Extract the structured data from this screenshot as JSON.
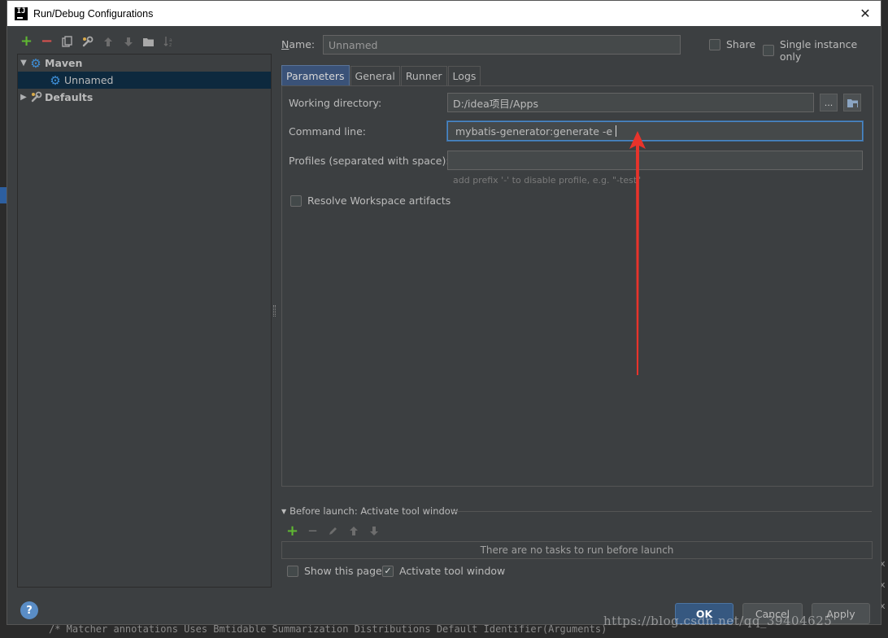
{
  "window": {
    "title": "Run/Debug Configurations",
    "app_icon_text": "IJ"
  },
  "tree": {
    "items": [
      {
        "label": "Maven",
        "expanded": true,
        "bold": true
      },
      {
        "label": "Unnamed",
        "selected": true
      },
      {
        "label": "Defaults",
        "expanded": false,
        "bold": true
      }
    ]
  },
  "form": {
    "name_label": "Name:",
    "name_value": "Unnamed",
    "share_label": "Share",
    "single_instance_label": "Single instance only",
    "tabs": [
      "Parameters",
      "General",
      "Runner",
      "Logs"
    ],
    "active_tab": "Parameters",
    "working_dir_label": "Working directory:",
    "working_dir_value": "D:/idea项目/Apps",
    "browse_label": "...",
    "command_line_label": "Command line:",
    "command_line_value": "mybatis-generator:generate -e",
    "profiles_label": "Profiles (separated with space):",
    "profiles_value": "",
    "profiles_hint": "add prefix '-' to disable profile, e.g. \"-test\"",
    "resolve_label": "Resolve Workspace artifacts"
  },
  "before_launch": {
    "title": "Before launch: Activate tool window",
    "empty_text": "There are no tasks to run before launch",
    "show_page_label": "Show this page",
    "activate_label": "Activate tool window",
    "activate_checked": true
  },
  "buttons": {
    "ok": "OK",
    "cancel": "Cancel",
    "apply": "Apply",
    "help": "?"
  },
  "watermark": "https://blog.csdn.net/qq_39404625",
  "background": {
    "bottom_code": "/*  Matcher annotations  Uses Bmtidable  Summarization  Distributions  Default Identifier(Arguments)"
  },
  "colors": {
    "accent": "#3a5278",
    "arrow": "#e8332b",
    "ok_button": "#365880"
  },
  "icons": [
    "add-icon",
    "remove-icon",
    "copy-icon",
    "wrench-icon",
    "move-up-icon",
    "move-down-icon",
    "folder-icon",
    "sort-icon",
    "maven-gear-icon",
    "defaults-wrench-icon",
    "help-icon",
    "close-icon"
  ]
}
